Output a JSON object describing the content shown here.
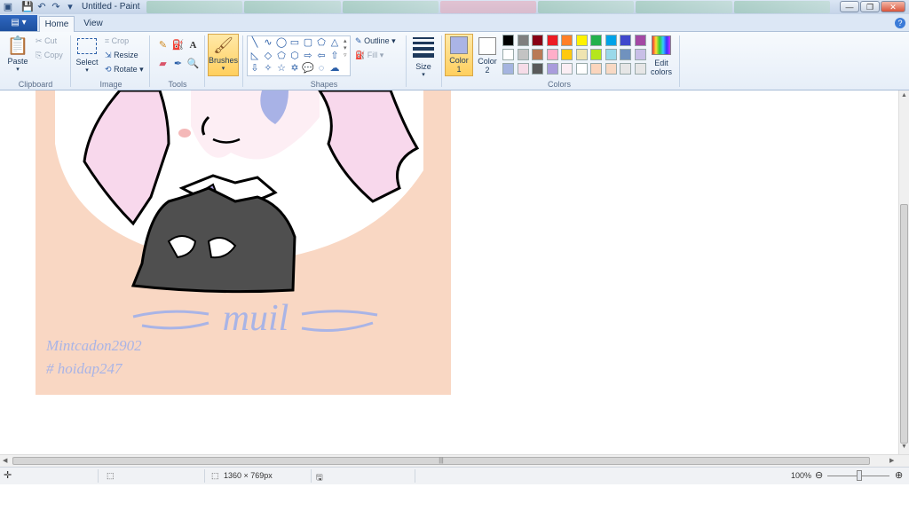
{
  "window": {
    "title": "Untitled - Paint",
    "minimize": "—",
    "maximize": "❐",
    "close": "✕"
  },
  "quick_access": [
    "save-icon",
    "undo-icon",
    "redo-icon",
    "customize-icon"
  ],
  "tabs": {
    "home": "Home",
    "view": "View"
  },
  "ribbon": {
    "clipboard": {
      "paste": "Paste",
      "cut": "Cut",
      "copy": "Copy",
      "label": "Clipboard"
    },
    "image": {
      "select": "Select",
      "crop": "Crop",
      "resize": "Resize",
      "rotate": "Rotate",
      "label": "Image"
    },
    "tools": {
      "label": "Tools"
    },
    "brushes": {
      "label": "Brushes"
    },
    "shapes": {
      "outline": "Outline",
      "fill": "Fill",
      "label": "Shapes"
    },
    "size": {
      "label": "Size"
    },
    "colors": {
      "color1": "Color",
      "color1_num": "1",
      "color2": "Color",
      "color2_num": "2",
      "edit": "Edit",
      "edit2": "colors",
      "label": "Colors",
      "color1_value": "#aab4e6",
      "color2_value": "#ffffff",
      "palette_row1": [
        "#000000",
        "#7f7f7f",
        "#880015",
        "#ed1c24",
        "#ff7f27",
        "#fff200",
        "#22b14c",
        "#00a2e8",
        "#3f48cc",
        "#a349a4"
      ],
      "palette_row2": [
        "#ffffff",
        "#c3c3c3",
        "#b97a57",
        "#ffaec9",
        "#ffc90e",
        "#efe4b0",
        "#b5e61d",
        "#99d9ea",
        "#7092be",
        "#c8bfe7"
      ],
      "palette_row3": [
        "#a5b4e0",
        "#f6dce8",
        "#5a5a5a",
        "#a99cdc",
        "#fbeef4",
        "#ffffff",
        "#fbd5bd",
        "#f8d9c4",
        "#e6e6e6",
        "#e6e6e6"
      ]
    }
  },
  "canvas": {
    "bg_color": "#f9d7c3",
    "signature": "muil",
    "credit_line1": "Mintcadon2902",
    "credit_line2": "# hoidap247"
  },
  "status": {
    "dimensions": "1360 × 769px",
    "zoom": "100%"
  }
}
